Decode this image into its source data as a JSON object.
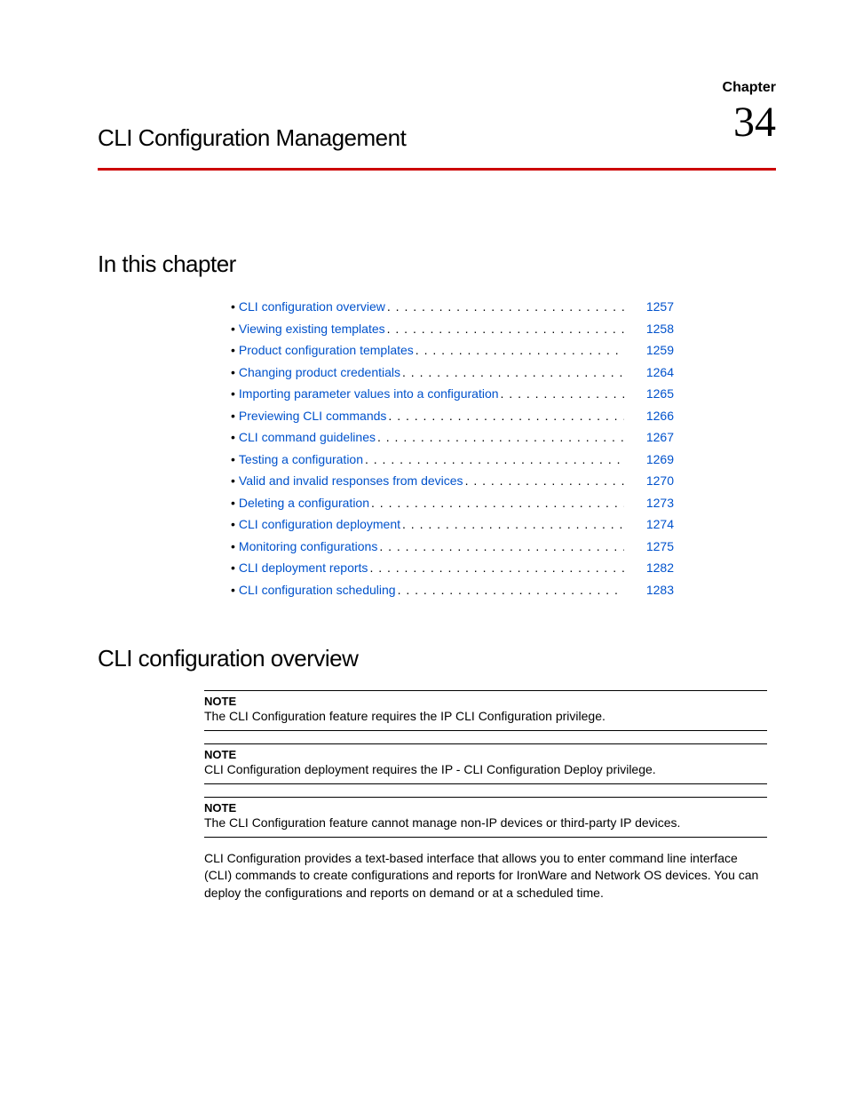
{
  "header": {
    "chapter_label": "Chapter",
    "chapter_number": "34",
    "chapter_title": "CLI Configuration Management"
  },
  "toc": {
    "heading": "In this chapter",
    "items": [
      {
        "label": "CLI configuration overview",
        "page": "1257"
      },
      {
        "label": "Viewing existing templates",
        "page": "1258"
      },
      {
        "label": "Product configuration templates",
        "page": "1259"
      },
      {
        "label": "Changing product credentials",
        "page": "1264"
      },
      {
        "label": "Importing parameter values into a configuration",
        "page": "1265"
      },
      {
        "label": "Previewing CLI commands",
        "page": "1266"
      },
      {
        "label": "CLI command guidelines",
        "page": "1267"
      },
      {
        "label": "Testing a configuration",
        "page": "1269"
      },
      {
        "label": "Valid and invalid responses from devices",
        "page": "1270"
      },
      {
        "label": "Deleting a configuration",
        "page": "1273"
      },
      {
        "label": "CLI configuration deployment",
        "page": "1274"
      },
      {
        "label": "Monitoring configurations",
        "page": "1275"
      },
      {
        "label": "CLI deployment reports",
        "page": "1282"
      },
      {
        "label": "CLI configuration scheduling",
        "page": "1283"
      }
    ]
  },
  "section": {
    "heading": "CLI configuration overview",
    "notes": [
      {
        "label": "NOTE",
        "text": "The CLI Configuration feature requires the IP CLI Configuration privilege."
      },
      {
        "label": "NOTE",
        "text": "CLI Configuration deployment requires the IP - CLI Configuration Deploy privilege."
      },
      {
        "label": "NOTE",
        "text": "The CLI Configuration feature cannot manage non-IP devices or third-party IP devices."
      }
    ],
    "paragraph": "CLI Configuration provides a text-based interface that allows you to enter command line interface (CLI) commands to create configurations and reports for IronWare and Network OS devices. You can deploy the configurations and reports on demand or at a scheduled time."
  }
}
